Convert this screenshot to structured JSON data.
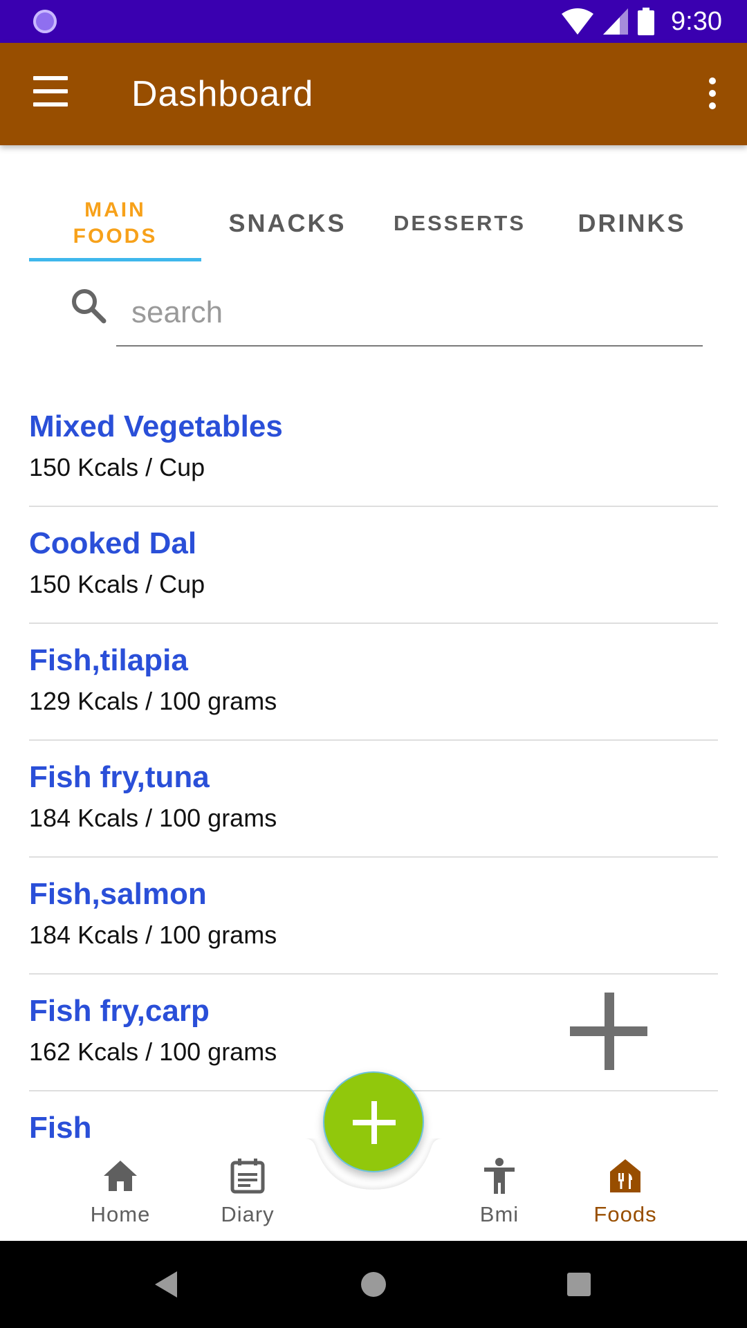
{
  "status_bar": {
    "time": "9:30"
  },
  "app_bar": {
    "title": "Dashboard"
  },
  "tabs": [
    {
      "label": "MAIN\nFOODS",
      "active": true
    },
    {
      "label": "SNACKS",
      "active": false
    },
    {
      "label": "DESSERTS",
      "active": false
    },
    {
      "label": "DRINKS",
      "active": false
    }
  ],
  "search": {
    "placeholder": "search",
    "value": ""
  },
  "foods": [
    {
      "name": "Mixed Vegetables",
      "kcal": "150 Kcals / Cup"
    },
    {
      "name": "Cooked Dal",
      "kcal": "150 Kcals / Cup"
    },
    {
      "name": "Fish,tilapia",
      "kcal": "129 Kcals / 100 grams"
    },
    {
      "name": "Fish fry,tuna",
      "kcal": "184 Kcals / 100 grams"
    },
    {
      "name": "Fish,salmon",
      "kcal": "184 Kcals / 100 grams"
    },
    {
      "name": "Fish fry,carp",
      "kcal": "162 Kcals / 100 grams"
    },
    {
      "name": "Fish",
      "kcal": ""
    }
  ],
  "bottom_nav": [
    {
      "label": "Home",
      "icon": "home-icon",
      "active": false
    },
    {
      "label": "Diary",
      "icon": "diary-icon",
      "active": false
    },
    {
      "label": "Bmi",
      "icon": "accessibility-icon",
      "active": false
    },
    {
      "label": "Foods",
      "icon": "restaurant-icon",
      "active": true
    }
  ],
  "colors": {
    "status_bar": "#3a00b0",
    "app_bar": "#984e00",
    "active_tab": "#f7a11a",
    "tab_indicator": "#3fb7ec",
    "food_name": "#2a4fd8",
    "fab": "#91c80c",
    "active_nav": "#984e00"
  }
}
